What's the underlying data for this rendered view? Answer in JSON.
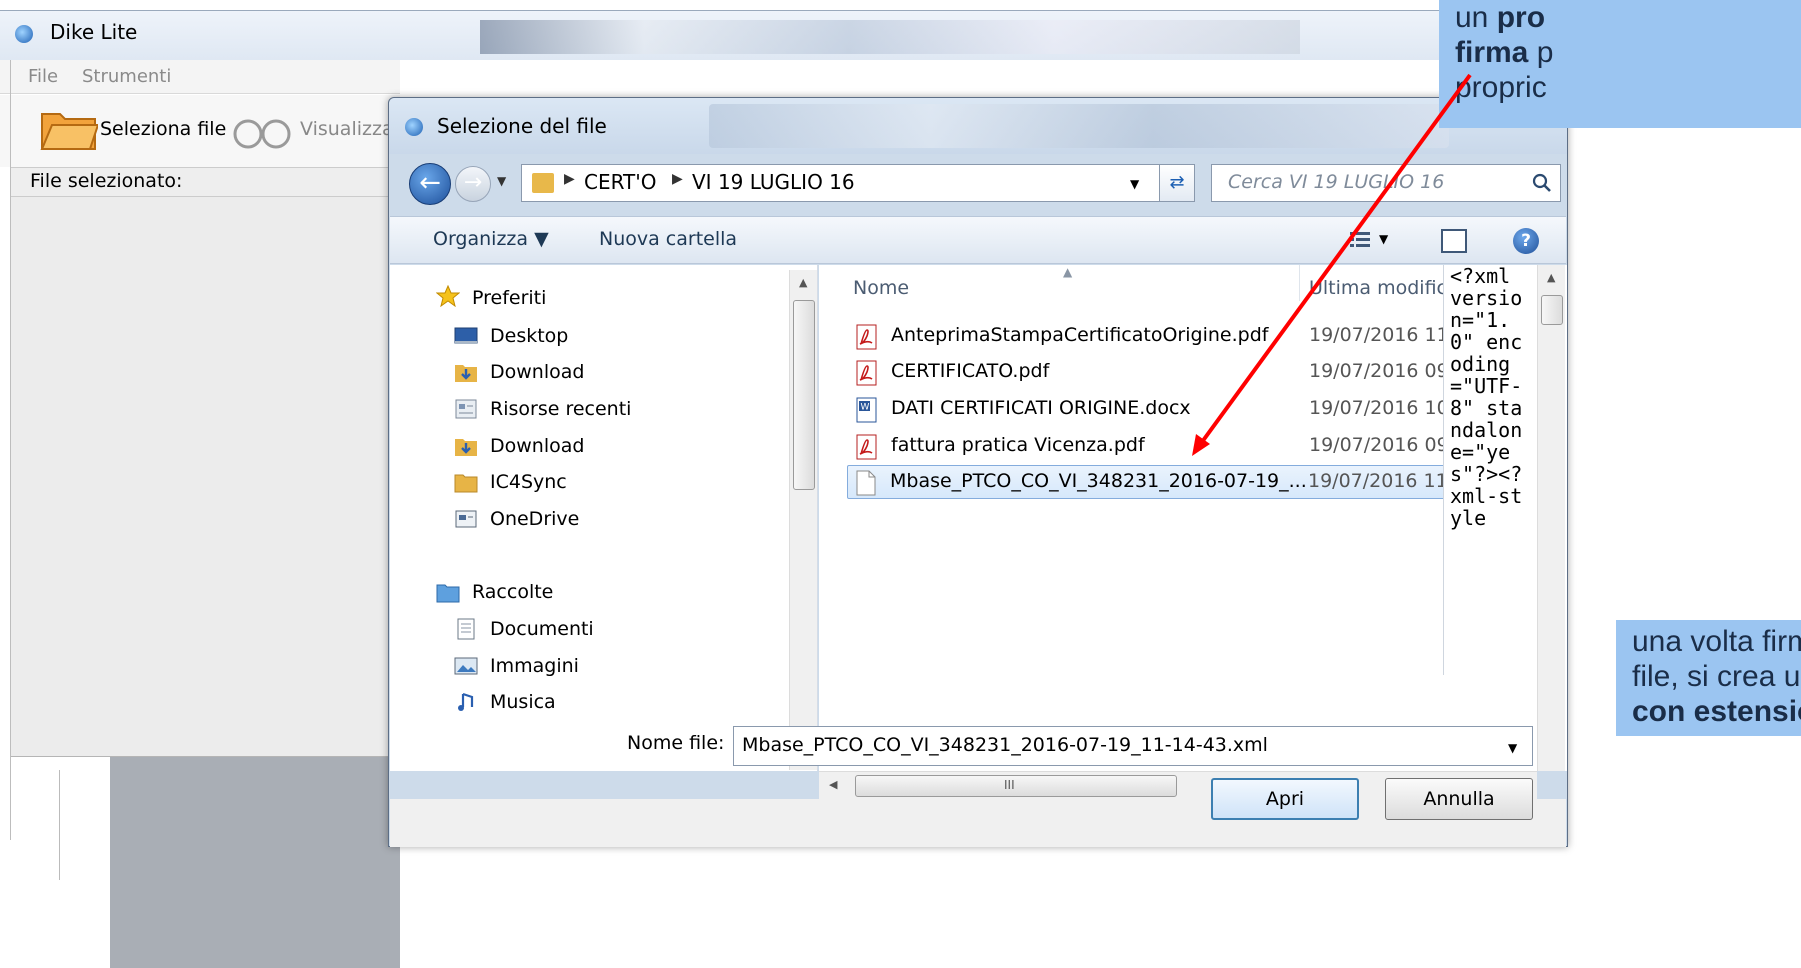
{
  "app": {
    "title": "Dike Lite",
    "menu": [
      "File",
      "Strumenti"
    ],
    "toolbar": {
      "seleziona_label": "Seleziona file",
      "visualizza_label": "Visualizza d"
    },
    "selected_file_label": "File selezionato:"
  },
  "dialog": {
    "title": "Selezione del file",
    "breadcrumb": [
      "CERT'O",
      "VI 19 LUGLIO 16"
    ],
    "search_placeholder": "Cerca VI 19 LUGLIO 16",
    "commands": {
      "organizza": "Organizza ▼",
      "nuova_cartella": "Nuova cartella"
    },
    "nav": {
      "favorites_header": "Preferiti",
      "favorites": [
        "Desktop",
        "Download",
        "Risorse recenti",
        "Download",
        "IC4Sync",
        "OneDrive"
      ],
      "libraries_header": "Raccolte",
      "libraries": [
        "Documenti",
        "Immagini",
        "Musica"
      ]
    },
    "columns": {
      "name": "Nome",
      "date": "Ultima modific"
    },
    "files": [
      {
        "name": "AnteprimaStampaCertificatoOrigine.pdf",
        "date": "19/07/2016 11:",
        "type": "pdf"
      },
      {
        "name": "CERTIFICATO.pdf",
        "date": "19/07/2016 09:",
        "type": "pdf"
      },
      {
        "name": "DATI CERTIFICATI ORIGINE.docx",
        "date": "19/07/2016 10:",
        "type": "docx"
      },
      {
        "name": "fattura pratica Vicenza.pdf",
        "date": "19/07/2016 09:",
        "type": "pdf"
      },
      {
        "name": "Mbase_PTCO_CO_VI_348231_2016-07-19_...",
        "date": "19/07/2016 11:",
        "type": "xml",
        "selected": true
      }
    ],
    "preview_text": "<?xml version=\"1.0\" encoding=\"UTF-8\" standalone=\"yes\"?><?xml-style",
    "filename_label": "Nome file:",
    "filename_value": "Mbase_PTCO_CO_VI_348231_2016-07-19_11-14-43.xml",
    "open_button": "Apri",
    "cancel_button": "Annulla"
  },
  "annotations": {
    "top": {
      "line1_a": "un ",
      "line1_b": "pro",
      "line2_a": "firma",
      "line2_b": " p",
      "line3": "propric"
    },
    "bottom": {
      "line1": "una volta firm",
      "line2": "file, si crea un",
      "line3": "con estension"
    },
    "arrow_color": "#ff0000",
    "callout_color": "#9bc5f1"
  }
}
